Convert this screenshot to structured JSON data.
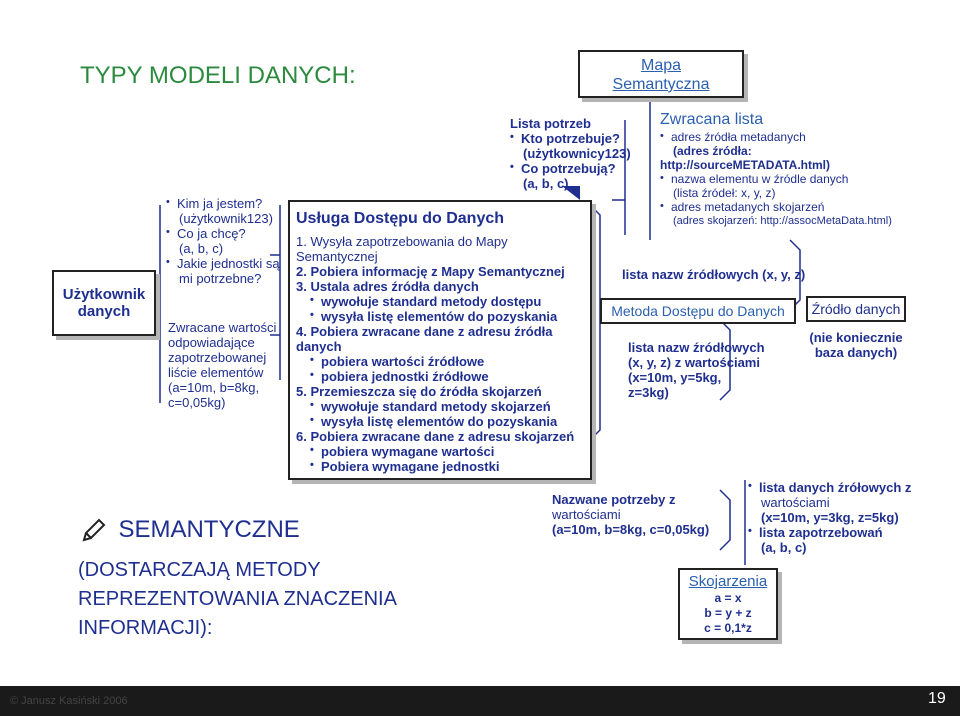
{
  "title": "TYPY MODELI DANYCH:",
  "user_box": {
    "line1": "Użytkownik",
    "line2": "danych"
  },
  "user_questions": {
    "q1": "Kim ja jestem?",
    "q1_answer": "(użytkownik123)",
    "q2": "Co ja chcę?",
    "q2_answer": "(a, b, c)",
    "q3": "Jakie jednostki są",
    "q3_cont": "mi potrzebne?"
  },
  "user_returned": {
    "l1": "Zwracane wartości",
    "l2": "odpowiadające",
    "l3": "zapotrzebowanej",
    "l4": "liście elementów",
    "l5": "(a=10m, b=8kg,",
    "l6": "c=0,05kg)"
  },
  "service": {
    "title": "Usługa Dostępu do Danych",
    "s1a": "1. Wysyła zapotrzebowania do Mapy",
    "s1b": "Semantycznej",
    "s2": "2. Pobiera informację z Mapy Semantycznej",
    "s3": "3. Ustala adres źródła danych",
    "s3_b1": "wywołuje standard metody dostępu",
    "s3_b2": "wysyła listę elementów do pozyskania",
    "s4a": "4. Pobiera zwracane dane z adresu źródła",
    "s4b": "danych",
    "s4_b1": "pobiera wartości źródłowe",
    "s4_b2": "pobiera jednostki źródłowe",
    "s5": "5. Przemieszcza się do źródła skojarzeń",
    "s5_b1": "wywołuje standard metody skojarzeń",
    "s5_b2": "wysyła listę elementów do pozyskania",
    "s6": "6. Pobiera zwracane dane z adresu skojarzeń",
    "s6_b1": "pobiera wymagane wartości",
    "s6_b2": "Pobiera wymagane jednostki"
  },
  "needs": {
    "title": "Lista potrzeb",
    "q1": "Kto potrzebuje?",
    "a1": "(użytkownicy123)",
    "q2": "Co potrzebują?",
    "a2": "(a, b, c)"
  },
  "semantic_map": {
    "line1": "Mapa",
    "line2": "Semantyczna"
  },
  "returned_list": {
    "title": "Zwracana lista",
    "i1": "adres źródła metadanych",
    "i1a": "(adres źródła:",
    "i1b": "http://sourceMETADATA.html)",
    "i2": "nazwa elementu w źródle danych",
    "i2a": "(lista źródeł: x, y, z)",
    "i3": "adres metadanych skojarzeń",
    "i3a": "(adres skojarzeń: http://assocMetaData.html)"
  },
  "source_names": "lista nazw źródłowych (x, y, z)",
  "access_method": "Metoda Dostępu do Danych",
  "data_source": {
    "title": "Źródło danych",
    "note1": "(nie koniecznie",
    "note2": "baza danych)"
  },
  "source_values": {
    "l1": "lista nazw źródłowych",
    "l2": "(x, y, z) z wartościami",
    "l3": "(x=10m, y=5kg,",
    "l4": "z=3kg)"
  },
  "named_needs": {
    "l1": "Nazwane potrzeby z",
    "l2": "wartościami",
    "l3": "(a=10m, b=8kg, c=0,05kg)"
  },
  "right_lists": {
    "i1": "lista danych źrółowych z",
    "i1a": "wartościami",
    "i1b": "(x=10m, y=3kg, z=5kg)",
    "i2": "lista zapotrzebowań",
    "i2a": "(a, b, c)"
  },
  "associations": {
    "title": "Skojarzenia",
    "f1": "a = x",
    "f2": "b = y + z",
    "f3": "c = 0,1*z"
  },
  "semantic_heading": "SEMANTYCZNE",
  "semantic_desc": {
    "l1": "(DOSTARCZAJĄ METODY",
    "l2": "REPREZENTOWANIA ZNACZENIA",
    "l3": "INFORMACJI):"
  },
  "footer": {
    "copyright": "© Janusz Kasiński 2006",
    "page": "19"
  },
  "colors": {
    "text": "#1f2f8f",
    "title": "#2b8a3e",
    "footer_bg": "#1a1a1a",
    "accent": "#2b5fb0"
  }
}
